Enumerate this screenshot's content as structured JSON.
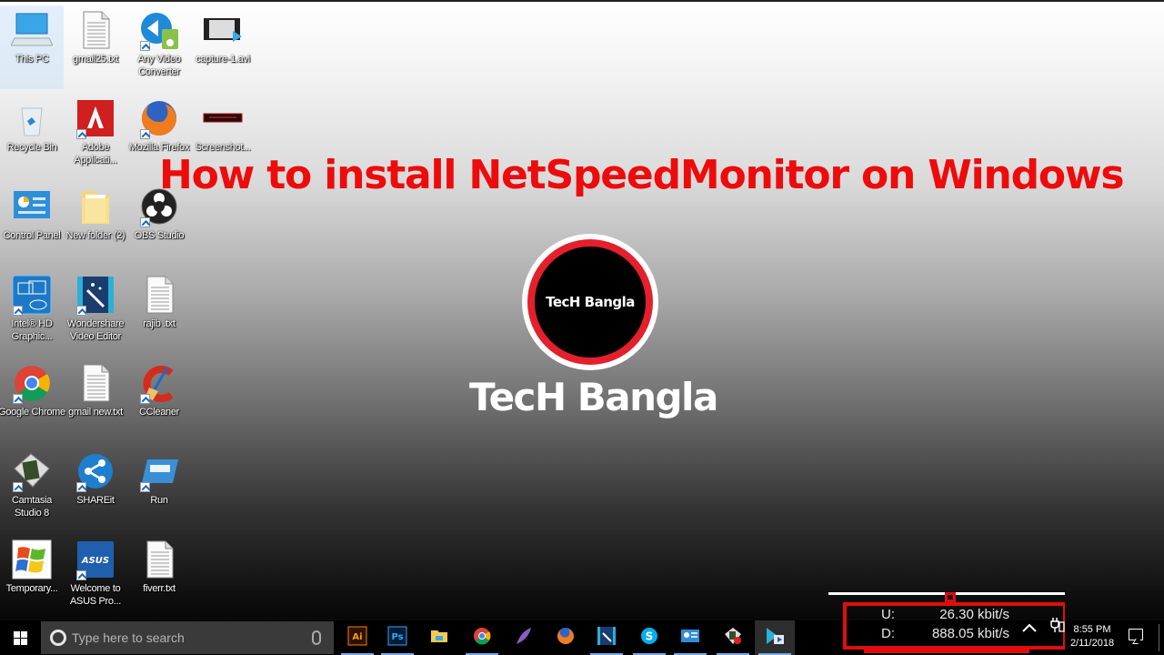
{
  "desktop": {
    "icons": [
      {
        "label": "This PC",
        "icon": "computer-icon",
        "shortcut": false,
        "selected": true
      },
      {
        "label": "gmail25.txt",
        "icon": "text-file-icon",
        "shortcut": false
      },
      {
        "label": "Any Video Converter",
        "icon": "video-converter-icon",
        "shortcut": true
      },
      {
        "label": "capture-1.avi",
        "icon": "video-file-icon",
        "shortcut": false
      },
      {
        "label": "Recycle Bin",
        "icon": "recycle-bin-icon",
        "shortcut": false
      },
      {
        "label": "Adobe Applicati...",
        "icon": "adobe-icon",
        "shortcut": true
      },
      {
        "label": "Mozilla Firefox",
        "icon": "firefox-icon",
        "shortcut": true
      },
      {
        "label": "Screenshot...",
        "icon": "image-file-icon",
        "shortcut": false
      },
      {
        "label": "Control Panel",
        "icon": "control-panel-icon",
        "shortcut": false
      },
      {
        "label": "New folder (2)",
        "icon": "folder-icon",
        "shortcut": false
      },
      {
        "label": "OBS Studio",
        "icon": "obs-icon",
        "shortcut": true
      },
      {
        "label": "Intel® HD Graphic...",
        "icon": "intel-graphics-icon",
        "shortcut": true
      },
      {
        "label": "Wondershare Video Editor",
        "icon": "video-editor-icon",
        "shortcut": true
      },
      {
        "label": "rajib .txt",
        "icon": "text-file-icon",
        "shortcut": false
      },
      {
        "label": "Google Chrome",
        "icon": "chrome-icon",
        "shortcut": true
      },
      {
        "label": "gmail new.txt",
        "icon": "text-file-icon",
        "shortcut": false
      },
      {
        "label": "CCleaner",
        "icon": "ccleaner-icon",
        "shortcut": true
      },
      {
        "label": "Camtasia Studio 8",
        "icon": "camtasia-icon",
        "shortcut": true
      },
      {
        "label": "SHAREit",
        "icon": "shareit-icon",
        "shortcut": true
      },
      {
        "label": "Run",
        "icon": "run-icon",
        "shortcut": true
      },
      {
        "label": "Temporary...",
        "icon": "windows-xp-icon",
        "shortcut": false
      },
      {
        "label": "Welcome to ASUS Pro...",
        "icon": "asus-icon",
        "shortcut": true
      },
      {
        "label": "fiverr.txt",
        "icon": "text-file-icon",
        "shortcut": false
      }
    ]
  },
  "overlay": {
    "headline": "How to install NetSpeedMonitor on Windows",
    "logo_text": "TecH Bangla",
    "brand_text": "TecH Bangla",
    "headline_color": "#ee0b0b"
  },
  "taskbar": {
    "search_placeholder": "Type here to search",
    "apps": [
      {
        "name": "Adobe Illustrator",
        "icon": "illustrator-icon",
        "glyph": "Ai",
        "running": true
      },
      {
        "name": "Adobe Photoshop",
        "icon": "photoshop-icon",
        "glyph": "Ps",
        "running": true
      },
      {
        "name": "File Explorer",
        "icon": "file-explorer-icon",
        "running": false
      },
      {
        "name": "Google Chrome",
        "icon": "chrome-icon",
        "running": true
      },
      {
        "name": "Feather app",
        "icon": "feather-icon",
        "running": false
      },
      {
        "name": "Firefox",
        "icon": "firefox-icon",
        "running": false
      },
      {
        "name": "Wondershare Video Editor",
        "icon": "video-editor-icon",
        "running": true
      },
      {
        "name": "Skype",
        "icon": "skype-icon",
        "running": true
      },
      {
        "name": "Control Panel",
        "icon": "control-panel-icon",
        "running": true
      },
      {
        "name": "Camtasia Recorder",
        "icon": "camtasia-recorder-icon",
        "running": true
      },
      {
        "name": "Media app",
        "icon": "media-player-icon",
        "running": true,
        "active": true
      }
    ]
  },
  "netspeed": {
    "upload_label": "U:",
    "upload_value": "26.30 kbit/s",
    "download_label": "D:",
    "download_value": "888.05 kbit/s"
  },
  "tray": {
    "time": "8:55 PM",
    "date": "2/11/2018"
  }
}
